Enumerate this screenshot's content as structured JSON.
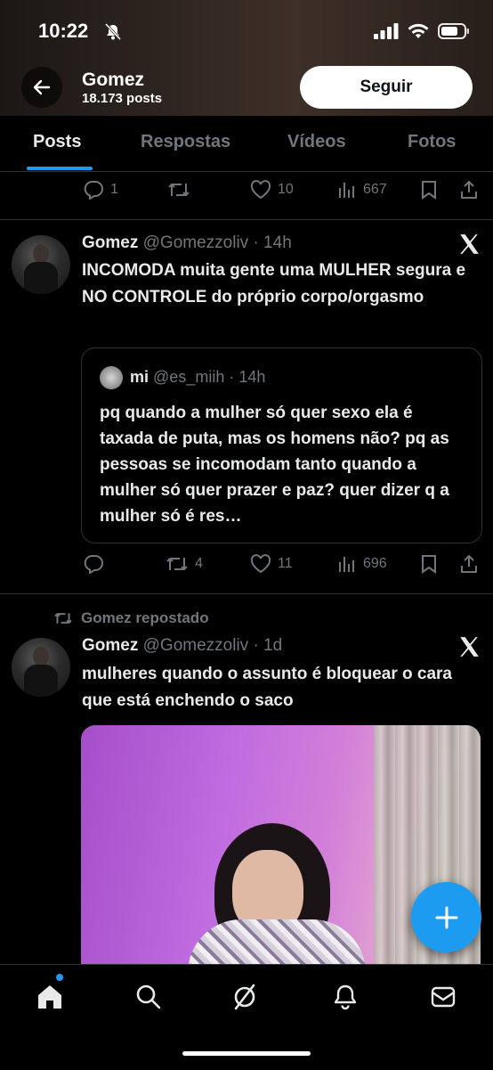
{
  "status_bar": {
    "time": "10:22"
  },
  "header": {
    "name": "Gomez",
    "posts_count": "18.173 posts",
    "follow_label": "Seguir"
  },
  "tabs": [
    {
      "label": "Posts",
      "active": true
    },
    {
      "label": "Respostas",
      "active": false
    },
    {
      "label": "Vídeos",
      "active": false
    },
    {
      "label": "Fotos",
      "active": false
    }
  ],
  "tweets": [
    {
      "replies": "1",
      "retweets": "",
      "likes": "10",
      "views": "667"
    },
    {
      "author": "Gomez",
      "handle_time": "@Gomezzoliv · 14h",
      "text": "INCOMODA muita gente uma MULHER segura e NO CONTROLE do próprio corpo/orgasmo",
      "quote": {
        "author": "mi",
        "handle_time": "@es_miih · 14h",
        "text": "pq quando a mulher só quer sexo ela é taxada de puta, mas os homens não? pq as pessoas se incomodam tanto quando a mulher só quer prazer e paz? quer dizer q a mulher só é res…"
      },
      "replies": "",
      "retweets": "4",
      "likes": "11",
      "views": "696"
    },
    {
      "reposted_by": "Gomez repostado",
      "author": "Gomez",
      "handle_time": "@Gomezzoliv · 1d",
      "text": "mulheres quando o assunto é bloquear o cara que está enchendo o saco"
    }
  ],
  "colors": {
    "accent": "#1d9bf0",
    "muted": "#71767b",
    "border": "#2f3336"
  }
}
